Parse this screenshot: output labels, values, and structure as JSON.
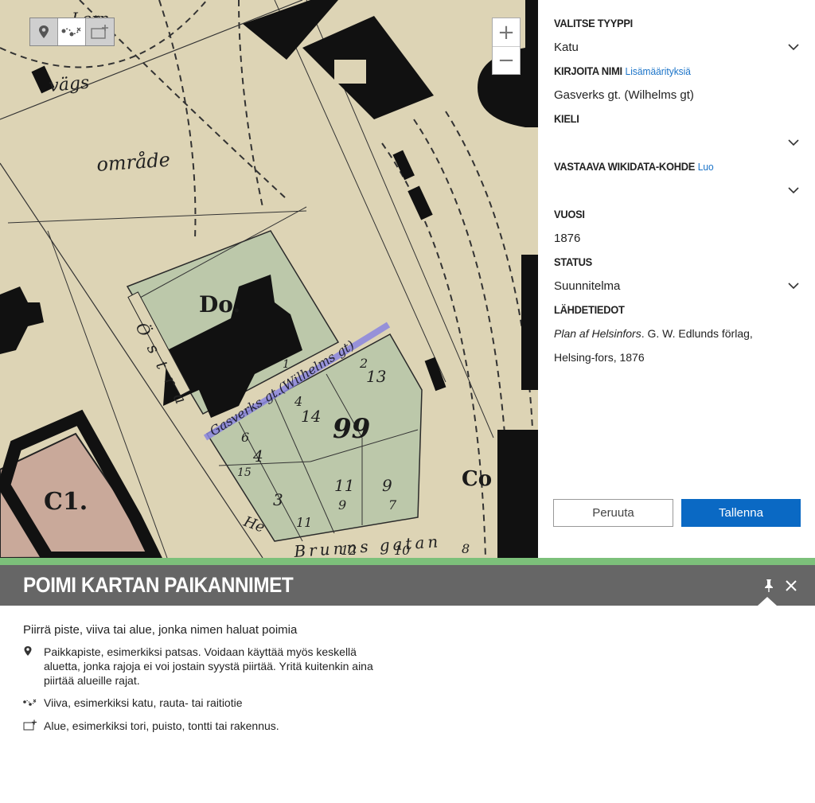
{
  "map": {
    "draw_tools": [
      {
        "name": "point-tool",
        "icon": "map-pin-icon",
        "active": false
      },
      {
        "name": "line-tool",
        "icon": "polyline-icon",
        "active": true
      },
      {
        "name": "area-tool",
        "icon": "add-area-icon",
        "active": false
      }
    ],
    "zoom_in": "+",
    "zoom_out": "−",
    "drawn_line_color": "#8a86e0",
    "labels": {
      "vags": "vägs",
      "omrade": "område",
      "do": "Do.",
      "c1": "C1.",
      "co": "Co",
      "block99": "99",
      "n14": "14",
      "n13": "13",
      "n2": "2",
      "n4": "4",
      "n6": "6",
      "n9": "9",
      "n11": "11",
      "n7": "7",
      "n3": "3",
      "n8": "8",
      "n10": "10",
      "n12": "12",
      "n15": "15",
      "n1": "1",
      "lern": "Lern-",
      "gasverks": "Gasverks gt.(Wilhelms gt)",
      "brunns": "Brunns gatan",
      "ostra": "Östra",
      "he": "He"
    }
  },
  "form": {
    "type_label": "VALITSE TYYPPI",
    "type_value": "Katu",
    "name_label": "KIRJOITA NIMI",
    "name_link": "Lisämäärityksiä",
    "name_value": "Gasverks gt. (Wilhelms gt)",
    "lang_label": "KIELI",
    "lang_value": "",
    "wikidata_label": "VASTAAVA WIKIDATA-KOHDE",
    "wikidata_link": "Luo",
    "wikidata_value": "",
    "year_label": "VUOSI",
    "year_value": "1876",
    "status_label": "STATUS",
    "status_value": "Suunnitelma",
    "source_label": "LÄHDETIEDOT",
    "source_title": "Plan af Helsinfors",
    "source_rest": ". G. W. Edlunds förlag, Helsing-fors, 1876",
    "cancel": "Peruuta",
    "save": "Tallenna",
    "accent_color": "#0a69c4"
  },
  "panel": {
    "title": "POIMI KARTAN PAIKANNIMET",
    "lead": "Piirrä piste, viiva tai alue, jonka nimen haluat poimia",
    "hints": [
      {
        "icon": "map-pin-icon",
        "text": "Paikkapiste, esimerkiksi patsas. Voidaan käyttää myös keskellä aluetta, jonka rajoja ei voi jostain syystä piirtää. Yritä kuitenkin aina piirtää alueille rajat."
      },
      {
        "icon": "polyline-icon",
        "text": "Viiva, esimerkiksi katu, rauta- tai raitiotie"
      },
      {
        "icon": "add-area-icon",
        "text": "Alue, esimerkiksi tori, puisto, tontti tai rakennus."
      }
    ],
    "bar_color": "#7cc07a",
    "header_color": "#666666"
  }
}
